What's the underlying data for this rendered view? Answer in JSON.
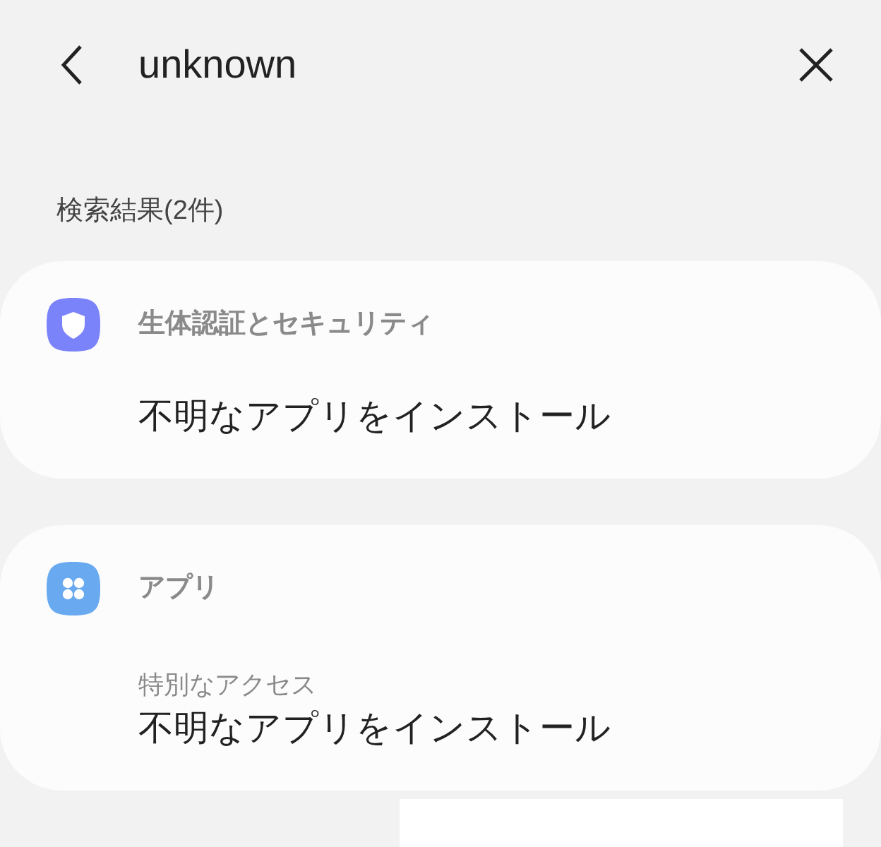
{
  "search": {
    "value": "unknown"
  },
  "results_heading": "検索結果(2件)",
  "results": [
    {
      "kind": "shield",
      "color": "#7b83fa",
      "category": "生体認証とセキュリティ",
      "title": "不明なアプリをインストール"
    },
    {
      "kind": "apps",
      "color": "#68a9f0",
      "category": "アプリ",
      "path": "特別なアクセス",
      "title": "不明なアプリをインストール"
    }
  ]
}
